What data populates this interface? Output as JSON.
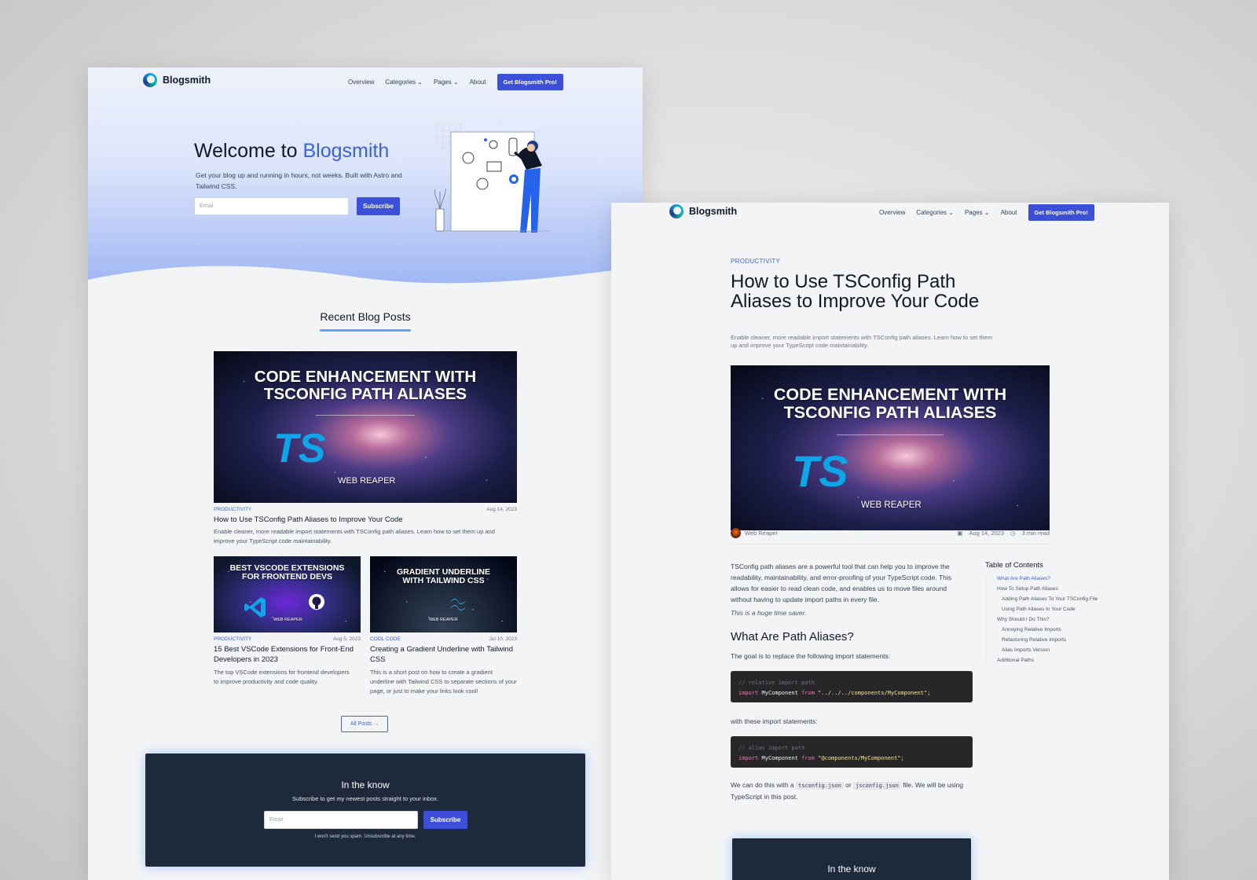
{
  "home": {
    "nav": {
      "brand": "Blogsmith",
      "links": [
        "Overview",
        "Categories",
        "Pages",
        "About"
      ],
      "cta": "Get Blogsmith Pro!"
    },
    "hero": {
      "title_prefix": "Welcome to ",
      "title_accent": "Blogsmith",
      "subtitle": "Get your blog up and running in hours, not weeks. Built with Astro and Tailwind CSS.",
      "email_placeholder": "Email",
      "subscribe": "Subscribe"
    },
    "recent_title": "Recent Blog Posts",
    "featured": {
      "image_heading_1": "CODE ENHANCEMENT WITH",
      "image_heading_2": "TSCONFIG PATH ALIASES",
      "image_logo": "TS",
      "image_author": "WEB REAPER",
      "category": "PRODUCTIVITY",
      "date": "Aug 14, 2023",
      "title": "How to Use TSConfig Path Aliases to Improve Your Code",
      "description": "Enable cleaner, more readable import statements with TSConfig path aliases. Learn how to set them up and improve your TypeScript code maintainability."
    },
    "posts": [
      {
        "image_heading_1": "BEST VSCODE EXTENSIONS",
        "image_heading_2": "FOR FRONTEND DEVS",
        "image_author": "WEB REAPER",
        "category": "PRODUCTIVITY",
        "date": "Aug 5, 2023",
        "title": "15 Best VSCode Extensions for Front-End Developers in 2023",
        "description": "The top VSCode extensions for frontend developers to improve productivity and code quality."
      },
      {
        "image_heading_1": "GRADIENT UNDERLINE",
        "image_heading_2": "WITH TAILWIND CSS",
        "image_author": "WEB REAPER",
        "category": "COOL CODE",
        "date": "Jul 10, 2023",
        "title": "Creating a Gradient Underline with Tailwind CSS",
        "description": "This is a short post on how to create a gradient underline with Tailwind CSS to separate sections of your page, or just to make your links look cool!"
      }
    ],
    "all_posts": "All Posts →",
    "newsletter": {
      "title": "In the know",
      "subtitle": "Subscribe to get my newest posts straight to your inbox.",
      "email_placeholder": "Email",
      "subscribe": "Subscribe",
      "note": "I won't send you spam. Unsubscribe at any time."
    }
  },
  "post": {
    "nav": {
      "brand": "Blogsmith",
      "links": [
        "Overview",
        "Categories",
        "Pages",
        "About"
      ],
      "cta": "Get Blogsmith Pro!"
    },
    "category": "PRODUCTIVITY",
    "title": "How to Use TSConfig Path Aliases to Improve Your Code",
    "lead": "Enable cleaner, more readable import statements with TSConfig path aliases. Learn how to set them up and improve your TypeScript code maintainability.",
    "image_heading_1": "CODE ENHANCEMENT WITH",
    "image_heading_2": "TSCONFIG PATH ALIASES",
    "image_logo": "TS",
    "image_author": "WEB REAPER",
    "author": "Web Reaper",
    "date": "Aug 14, 2023",
    "read_time": "3 min read",
    "intro": "TSConfig path aliases are a powerful tool that can help you to improve the readability, maintainability, and error-proofing of your TypeScript code. This allows for easier to read clean code, and enables us to move files around without having to update import paths in every file.",
    "italic": "This is a huge time saver.",
    "h2": "What Are Path Aliases?",
    "p_goal": "The goal is to replace the following import statements:",
    "code1": {
      "comment": "// relative import path",
      "kw_import": "import",
      "ident": "MyComponent",
      "kw_from": "from",
      "path": "\"../../../components/MyComponent\";"
    },
    "p_with": "with these import statements:",
    "code2": {
      "comment": "// alias import path",
      "kw_import": "import",
      "ident": "MyComponent",
      "kw_from": "from",
      "path": "\"@components/MyComponent\";"
    },
    "p_do_1": "We can do this with a ",
    "p_do_code1": "tsconfig.json",
    "p_do_2": " or ",
    "p_do_code2": "jsconfig.json",
    "p_do_3": " file. We will be using TypeScript in this post.",
    "toc": {
      "title": "Table of Contents",
      "items": [
        {
          "label": "What Are Path Aliases?",
          "level": 1,
          "active": true
        },
        {
          "label": "How To Setup Path Aliases",
          "level": 1
        },
        {
          "label": "Adding Path Aliases To Your TSConfig File",
          "level": 2
        },
        {
          "label": "Using Path Aliases In Your Code",
          "level": 2
        },
        {
          "label": "Why Should I Do This?",
          "level": 1
        },
        {
          "label": "Annoying Relative Imports",
          "level": 2
        },
        {
          "label": "Refactoring Relative Imports",
          "level": 2
        },
        {
          "label": "Alias Imports Version",
          "level": 2
        },
        {
          "label": "Additional Paths",
          "level": 1
        }
      ]
    },
    "newsletter_title": "In the know"
  },
  "colors": {
    "accent": "#3b4fd8",
    "link": "#3b63d8",
    "newsletter_bg": "#1e293b",
    "code_bg": "#27272a"
  }
}
